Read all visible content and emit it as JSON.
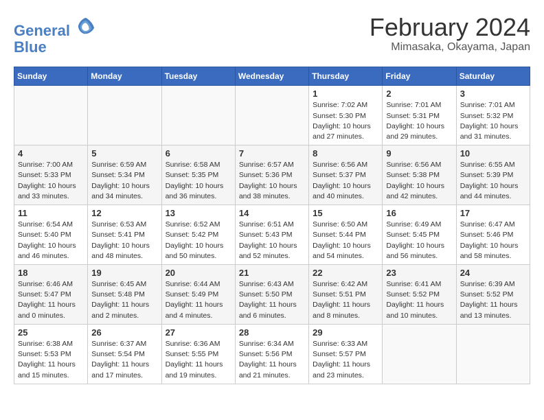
{
  "logo": {
    "line1": "General",
    "line2": "Blue"
  },
  "title": "February 2024",
  "location": "Mimasaka, Okayama, Japan",
  "weekdays": [
    "Sunday",
    "Monday",
    "Tuesday",
    "Wednesday",
    "Thursday",
    "Friday",
    "Saturday"
  ],
  "weeks": [
    [
      {
        "day": "",
        "sunrise": "",
        "sunset": "",
        "daylight": ""
      },
      {
        "day": "",
        "sunrise": "",
        "sunset": "",
        "daylight": ""
      },
      {
        "day": "",
        "sunrise": "",
        "sunset": "",
        "daylight": ""
      },
      {
        "day": "",
        "sunrise": "",
        "sunset": "",
        "daylight": ""
      },
      {
        "day": "1",
        "sunrise": "Sunrise: 7:02 AM",
        "sunset": "Sunset: 5:30 PM",
        "daylight": "Daylight: 10 hours and 27 minutes."
      },
      {
        "day": "2",
        "sunrise": "Sunrise: 7:01 AM",
        "sunset": "Sunset: 5:31 PM",
        "daylight": "Daylight: 10 hours and 29 minutes."
      },
      {
        "day": "3",
        "sunrise": "Sunrise: 7:01 AM",
        "sunset": "Sunset: 5:32 PM",
        "daylight": "Daylight: 10 hours and 31 minutes."
      }
    ],
    [
      {
        "day": "4",
        "sunrise": "Sunrise: 7:00 AM",
        "sunset": "Sunset: 5:33 PM",
        "daylight": "Daylight: 10 hours and 33 minutes."
      },
      {
        "day": "5",
        "sunrise": "Sunrise: 6:59 AM",
        "sunset": "Sunset: 5:34 PM",
        "daylight": "Daylight: 10 hours and 34 minutes."
      },
      {
        "day": "6",
        "sunrise": "Sunrise: 6:58 AM",
        "sunset": "Sunset: 5:35 PM",
        "daylight": "Daylight: 10 hours and 36 minutes."
      },
      {
        "day": "7",
        "sunrise": "Sunrise: 6:57 AM",
        "sunset": "Sunset: 5:36 PM",
        "daylight": "Daylight: 10 hours and 38 minutes."
      },
      {
        "day": "8",
        "sunrise": "Sunrise: 6:56 AM",
        "sunset": "Sunset: 5:37 PM",
        "daylight": "Daylight: 10 hours and 40 minutes."
      },
      {
        "day": "9",
        "sunrise": "Sunrise: 6:56 AM",
        "sunset": "Sunset: 5:38 PM",
        "daylight": "Daylight: 10 hours and 42 minutes."
      },
      {
        "day": "10",
        "sunrise": "Sunrise: 6:55 AM",
        "sunset": "Sunset: 5:39 PM",
        "daylight": "Daylight: 10 hours and 44 minutes."
      }
    ],
    [
      {
        "day": "11",
        "sunrise": "Sunrise: 6:54 AM",
        "sunset": "Sunset: 5:40 PM",
        "daylight": "Daylight: 10 hours and 46 minutes."
      },
      {
        "day": "12",
        "sunrise": "Sunrise: 6:53 AM",
        "sunset": "Sunset: 5:41 PM",
        "daylight": "Daylight: 10 hours and 48 minutes."
      },
      {
        "day": "13",
        "sunrise": "Sunrise: 6:52 AM",
        "sunset": "Sunset: 5:42 PM",
        "daylight": "Daylight: 10 hours and 50 minutes."
      },
      {
        "day": "14",
        "sunrise": "Sunrise: 6:51 AM",
        "sunset": "Sunset: 5:43 PM",
        "daylight": "Daylight: 10 hours and 52 minutes."
      },
      {
        "day": "15",
        "sunrise": "Sunrise: 6:50 AM",
        "sunset": "Sunset: 5:44 PM",
        "daylight": "Daylight: 10 hours and 54 minutes."
      },
      {
        "day": "16",
        "sunrise": "Sunrise: 6:49 AM",
        "sunset": "Sunset: 5:45 PM",
        "daylight": "Daylight: 10 hours and 56 minutes."
      },
      {
        "day": "17",
        "sunrise": "Sunrise: 6:47 AM",
        "sunset": "Sunset: 5:46 PM",
        "daylight": "Daylight: 10 hours and 58 minutes."
      }
    ],
    [
      {
        "day": "18",
        "sunrise": "Sunrise: 6:46 AM",
        "sunset": "Sunset: 5:47 PM",
        "daylight": "Daylight: 11 hours and 0 minutes."
      },
      {
        "day": "19",
        "sunrise": "Sunrise: 6:45 AM",
        "sunset": "Sunset: 5:48 PM",
        "daylight": "Daylight: 11 hours and 2 minutes."
      },
      {
        "day": "20",
        "sunrise": "Sunrise: 6:44 AM",
        "sunset": "Sunset: 5:49 PM",
        "daylight": "Daylight: 11 hours and 4 minutes."
      },
      {
        "day": "21",
        "sunrise": "Sunrise: 6:43 AM",
        "sunset": "Sunset: 5:50 PM",
        "daylight": "Daylight: 11 hours and 6 minutes."
      },
      {
        "day": "22",
        "sunrise": "Sunrise: 6:42 AM",
        "sunset": "Sunset: 5:51 PM",
        "daylight": "Daylight: 11 hours and 8 minutes."
      },
      {
        "day": "23",
        "sunrise": "Sunrise: 6:41 AM",
        "sunset": "Sunset: 5:52 PM",
        "daylight": "Daylight: 11 hours and 10 minutes."
      },
      {
        "day": "24",
        "sunrise": "Sunrise: 6:39 AM",
        "sunset": "Sunset: 5:52 PM",
        "daylight": "Daylight: 11 hours and 13 minutes."
      }
    ],
    [
      {
        "day": "25",
        "sunrise": "Sunrise: 6:38 AM",
        "sunset": "Sunset: 5:53 PM",
        "daylight": "Daylight: 11 hours and 15 minutes."
      },
      {
        "day": "26",
        "sunrise": "Sunrise: 6:37 AM",
        "sunset": "Sunset: 5:54 PM",
        "daylight": "Daylight: 11 hours and 17 minutes."
      },
      {
        "day": "27",
        "sunrise": "Sunrise: 6:36 AM",
        "sunset": "Sunset: 5:55 PM",
        "daylight": "Daylight: 11 hours and 19 minutes."
      },
      {
        "day": "28",
        "sunrise": "Sunrise: 6:34 AM",
        "sunset": "Sunset: 5:56 PM",
        "daylight": "Daylight: 11 hours and 21 minutes."
      },
      {
        "day": "29",
        "sunrise": "Sunrise: 6:33 AM",
        "sunset": "Sunset: 5:57 PM",
        "daylight": "Daylight: 11 hours and 23 minutes."
      },
      {
        "day": "",
        "sunrise": "",
        "sunset": "",
        "daylight": ""
      },
      {
        "day": "",
        "sunrise": "",
        "sunset": "",
        "daylight": ""
      }
    ]
  ]
}
